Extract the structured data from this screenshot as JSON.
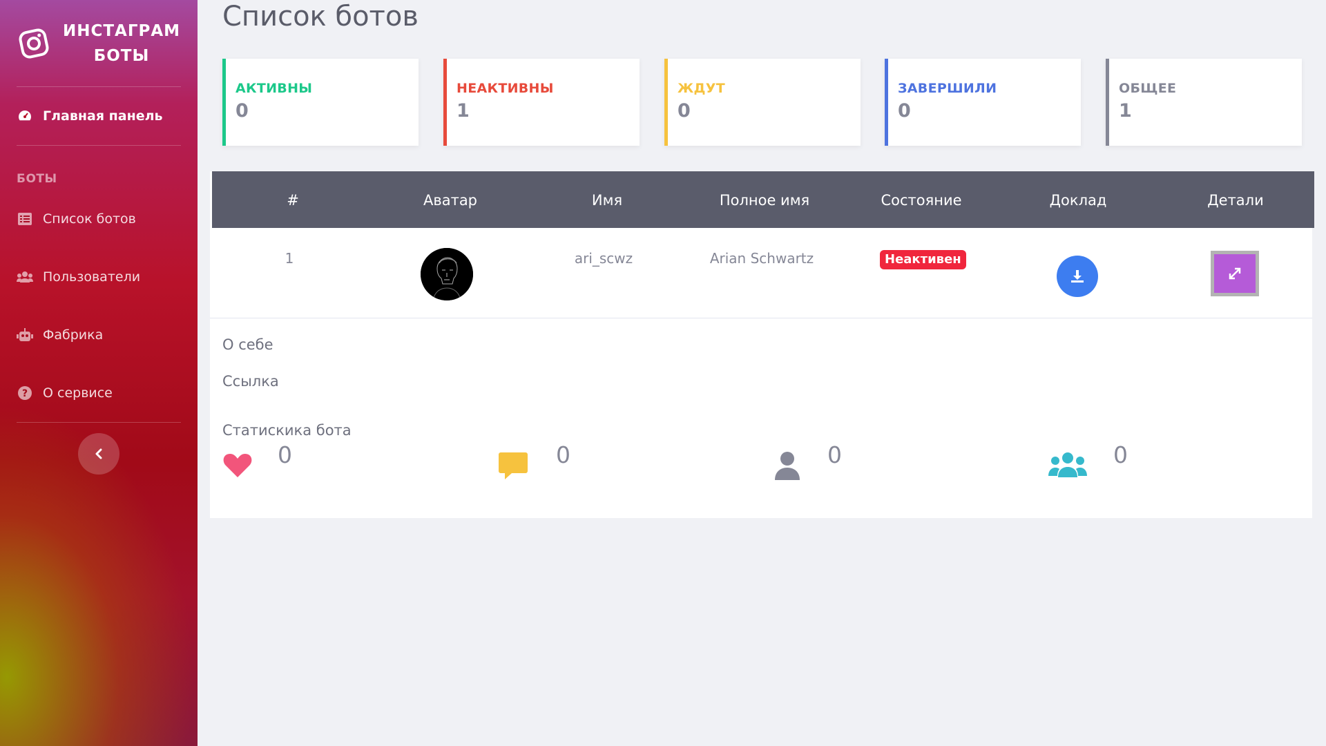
{
  "brand": {
    "line1": "ИНСТАГРАМ",
    "line2": "БОТЫ"
  },
  "sidebar": {
    "dashboard": "Главная панель",
    "section_title": "БОТЫ",
    "items": [
      {
        "label": "Список ботов",
        "icon": "list-icon"
      },
      {
        "label": "Пользователи",
        "icon": "users-icon"
      },
      {
        "label": "Фабрика",
        "icon": "robot-icon"
      },
      {
        "label": "О сервисе",
        "icon": "question-icon"
      }
    ]
  },
  "page": {
    "title": "Список ботов"
  },
  "cards": [
    {
      "label": "АКТИВНЫ",
      "value": "0",
      "color": "#1cc88a"
    },
    {
      "label": "НЕАКТИВНЫ",
      "value": "1",
      "color": "#e74a3b"
    },
    {
      "label": "ЖДУТ",
      "value": "0",
      "color": "#f6c23e"
    },
    {
      "label": "ЗАВЕРШИЛИ",
      "value": "0",
      "color": "#4e73df"
    },
    {
      "label": "ОБЩЕЕ",
      "value": "1",
      "color": "#858796"
    }
  ],
  "table": {
    "headers": [
      "#",
      "Аватар",
      "Имя",
      "Полное имя",
      "Состояние",
      "Доклад",
      "Детали"
    ],
    "row": {
      "index": "1",
      "username": "ari_scwz",
      "full_name": "Arian Schwartz",
      "status": "Неактивен"
    }
  },
  "details": {
    "about_label": "О себе",
    "link_label": "Ссылка",
    "stats_title": "Статискика бота",
    "stats": [
      {
        "icon": "heart-icon",
        "value": "0",
        "color": "#f2557b"
      },
      {
        "icon": "comment-icon",
        "value": "0",
        "color": "#f6c23e"
      },
      {
        "icon": "user-icon",
        "value": "0",
        "color": "#858796"
      },
      {
        "icon": "users-icon",
        "value": "0",
        "color": "#36b9cc"
      }
    ]
  }
}
